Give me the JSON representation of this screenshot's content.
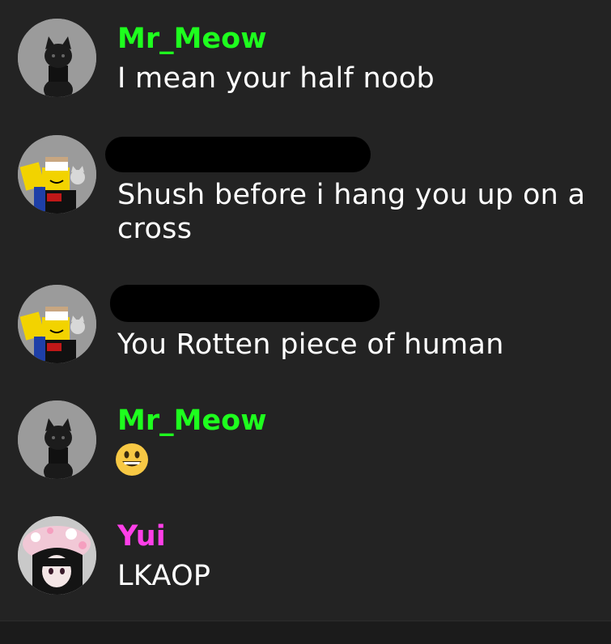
{
  "messages": [
    {
      "username": "Mr_Meow",
      "username_color": "#1eff1e",
      "avatar": "black-cat-avatar",
      "text": "I mean your half noob"
    },
    {
      "username": "",
      "username_redacted": true,
      "avatar": "noob-cat-avatar",
      "text": "Shush before i hang you up on a cross"
    },
    {
      "username": "",
      "username_redacted": true,
      "avatar": "noob-cat-avatar",
      "text": "You Rotten piece of human"
    },
    {
      "username": "Mr_Meow",
      "username_color": "#1eff1e",
      "avatar": "black-cat-avatar",
      "emoji": "grinning-face-emoji"
    },
    {
      "username": "Yui",
      "username_color": "#ff3fe8",
      "avatar": "pink-hat-girl-avatar",
      "text": "LKAOP"
    }
  ],
  "colors": {
    "background": "#232323",
    "text": "#ffffff",
    "green_user": "#1eff1e",
    "pink_user": "#ff3fe8",
    "avatar_bg": "#9a9a9a"
  }
}
